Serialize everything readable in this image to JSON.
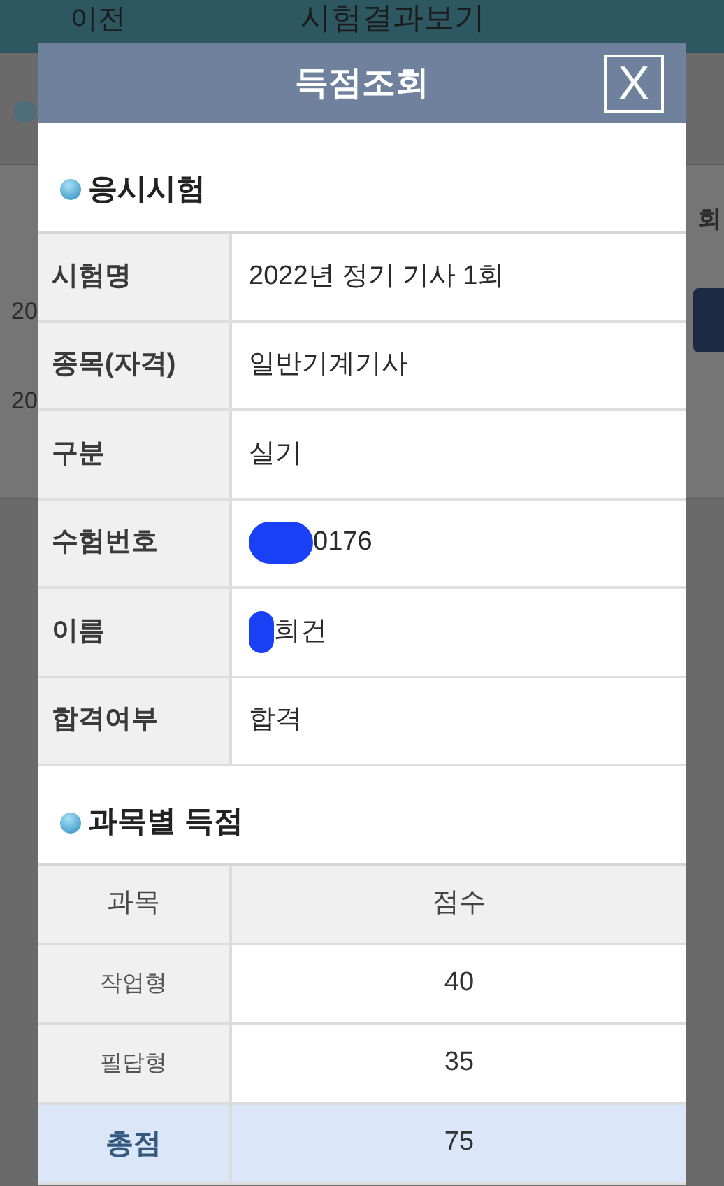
{
  "background_page": {
    "back_link": "이전",
    "title": "시험결과보기",
    "column_fragment": "회",
    "row_fragments": [
      "20",
      "20"
    ]
  },
  "dialog": {
    "title": "득점조회",
    "close_symbol": "X",
    "exam_section": {
      "heading": "응시시험",
      "rows": [
        {
          "label": "시험명",
          "value": "2022년 정기 기사 1회",
          "redacted": false
        },
        {
          "label": "종목(자격)",
          "value": "일반기계기사",
          "redacted": false
        },
        {
          "label": "구분",
          "value": "실기",
          "redacted": false
        },
        {
          "label": "수험번호",
          "value": "0176",
          "redacted": true
        },
        {
          "label": "이름",
          "value": "희건",
          "redacted": true
        },
        {
          "label": "합격여부",
          "value": "합격",
          "redacted": false
        }
      ]
    },
    "score_section": {
      "heading": "과목별 득점",
      "columns": [
        "과목",
        "점수"
      ],
      "rows": [
        {
          "subject": "작업형",
          "score": "40",
          "kind": "subject"
        },
        {
          "subject": "필답형",
          "score": "35",
          "kind": "subject"
        },
        {
          "subject": "총점",
          "score": "75",
          "kind": "total"
        }
      ]
    }
  }
}
